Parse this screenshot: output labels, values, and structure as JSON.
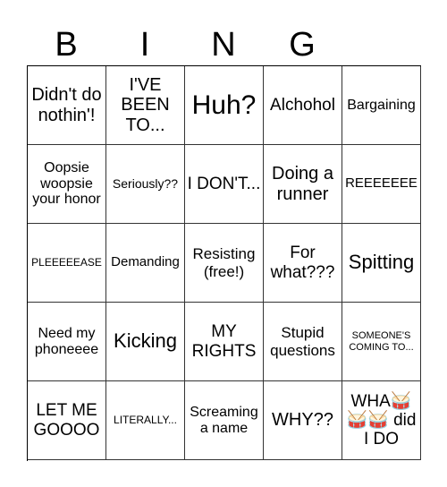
{
  "header": {
    "letters": [
      "B",
      "I",
      "N",
      "G",
      ""
    ]
  },
  "cells": [
    "Didn't do nothin'!",
    "I'VE BEEN TO...",
    "Huh?",
    "Alchohol",
    "Bargaining",
    "Oopsie woopsie your honor",
    "Seriously??",
    "I DON'T...",
    "Doing a runner",
    "REEEEEEE",
    "PLEEEEEASE",
    "Demanding",
    "Resisting (free!)",
    "For what???",
    "Spitting",
    "Need my phoneeee",
    "Kicking",
    "MY RIGHTS",
    "Stupid questions",
    "SOMEONE'S COMING TO...",
    "LET ME GOOOO",
    "LITERALLY...",
    "Screaming a name",
    "WHY??",
    "WHA🥁🥁🥁 did I DO"
  ]
}
